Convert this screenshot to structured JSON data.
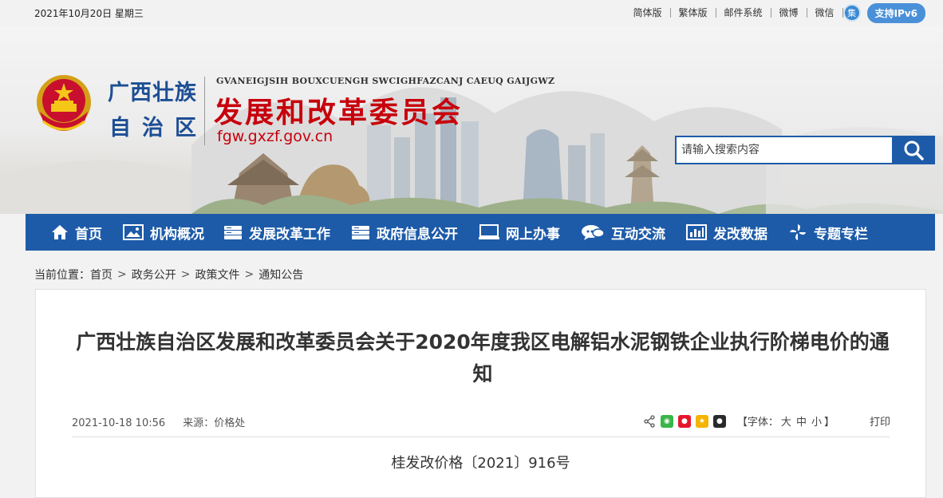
{
  "topbar": {
    "date": "2021年10月20日  星期三",
    "links": [
      "简体版",
      "繁体版",
      "邮件系统",
      "微博",
      "微信"
    ],
    "ipv6_icon_label": "集",
    "ipv6_label": "支持IPv6"
  },
  "header": {
    "region_line1": "广西壮族",
    "region_line2": "自治区",
    "zhuang_name": "GVANEIGJSIH BOUXCUENGH SWCIGHFAZCANJ CAEUQ GAIJGWZ",
    "org_name": "发展和改革委员会",
    "domain": "fgw.gxzf.gov.cn"
  },
  "search": {
    "placeholder": "请输入搜索内容",
    "icon": "search-icon"
  },
  "nav": {
    "items": [
      {
        "label": "首页",
        "icon": "home-icon"
      },
      {
        "label": "机构概况",
        "icon": "image-icon"
      },
      {
        "label": "发展改革工作",
        "icon": "stack-icon"
      },
      {
        "label": "政府信息公开",
        "icon": "stack-icon"
      },
      {
        "label": "网上办事",
        "icon": "monitor-icon"
      },
      {
        "label": "互动交流",
        "icon": "chat-icon"
      },
      {
        "label": "发改数据",
        "icon": "bar-chart-icon"
      },
      {
        "label": "专题专栏",
        "icon": "pinwheel-icon"
      }
    ]
  },
  "breadcrumb": {
    "prefix": "当前位置：",
    "items": [
      "首页",
      "政务公开",
      "政策文件",
      "通知公告"
    ]
  },
  "article": {
    "title": "广西壮族自治区发展和改革委员会关于2020年度我区电解铝水泥钢铁企业执行阶梯电价的通知",
    "date": "2021-10-18 10:56",
    "source": "来源：价格处",
    "font_label_open": "【字体：",
    "font_sizes": [
      "大",
      "中",
      "小"
    ],
    "font_label_close": "】",
    "print_label": "打印",
    "doc_number": "桂发改价格〔2021〕916号"
  },
  "colors": {
    "brand_blue": "#1d5ba8",
    "brand_red": "#c7000b",
    "ipv6_blue": "#4a90d9"
  }
}
